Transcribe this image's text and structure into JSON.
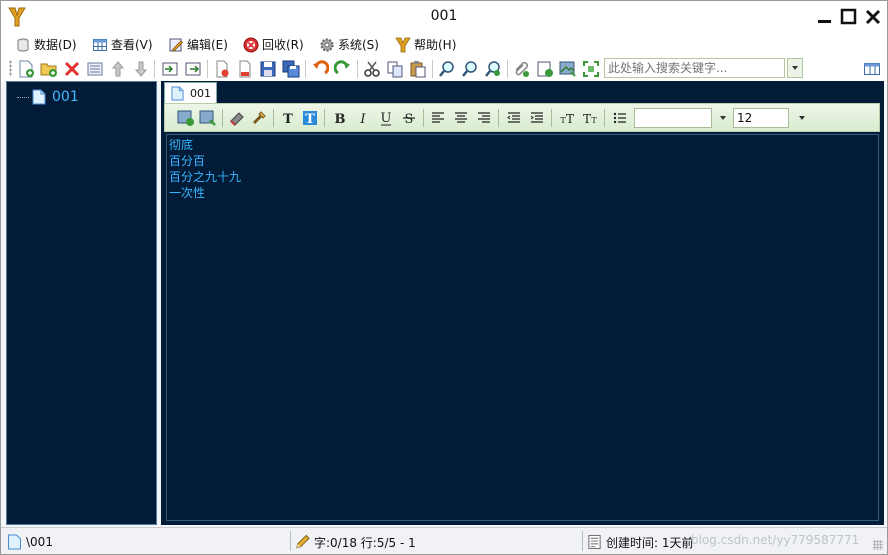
{
  "window": {
    "title": "001"
  },
  "menu": {
    "items": [
      {
        "label": "数据(D)",
        "icon": "database-icon"
      },
      {
        "label": "查看(V)",
        "icon": "table-view-icon"
      },
      {
        "label": "编辑(E)",
        "icon": "edit-icon"
      },
      {
        "label": "回收(R)",
        "icon": "recycle-icon"
      },
      {
        "label": "系统(S)",
        "icon": "gear-icon"
      },
      {
        "label": "帮助(H)",
        "icon": "help-logo-icon"
      }
    ]
  },
  "toolbar": {
    "search_placeholder": "此处输入搜索关键字..."
  },
  "tree": {
    "items": [
      {
        "label": "001"
      }
    ]
  },
  "tabs": [
    {
      "label": "001"
    }
  ],
  "format": {
    "font_value": "",
    "size_value": "12"
  },
  "editor": {
    "lines": [
      "彻底",
      "百分百",
      "百分之九十九",
      "一次性"
    ]
  },
  "status": {
    "path": "\\001",
    "position": "字:0/18 行:5/5 - 1",
    "created": "创建时间: 1天前",
    "watermark": "blog.csdn.net/yy779587771"
  },
  "colors": {
    "panel_bg": "#021b37",
    "editor_text": "#38b6ff",
    "tree_text": "#45b8ff"
  }
}
